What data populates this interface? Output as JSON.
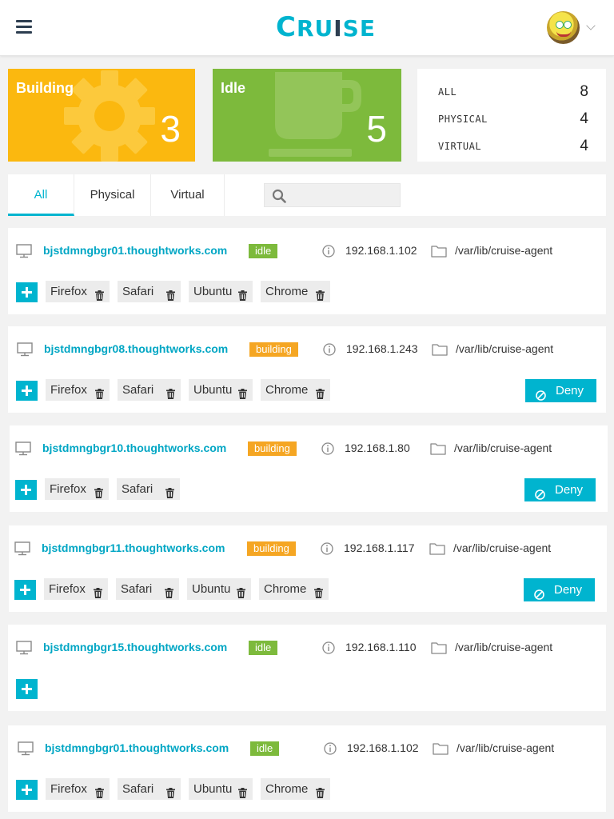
{
  "header": {
    "logo_1": "C",
    "logo_2": "RU",
    "logo_3": "I",
    "logo_4": "SE"
  },
  "summary": {
    "building_label": "Building",
    "building_count": "3",
    "idle_label": "Idle",
    "idle_count": "5",
    "totals": [
      {
        "label": "ALL",
        "value": "8"
      },
      {
        "label": "PHYSICAL",
        "value": "4"
      },
      {
        "label": "VIRTUAL",
        "value": "4"
      }
    ]
  },
  "tabs": [
    "All",
    "Physical",
    "Virtual"
  ],
  "search": {
    "placeholder": ""
  },
  "deny_label": "Deny",
  "agents": [
    {
      "host": "bjstdmngbgr01.thoughtworks.com",
      "status": "idle",
      "ip": "192.168.1.102",
      "path": "/var/lib/cruise-agent",
      "resources": [
        "Firefox",
        "Safari",
        "Ubuntu",
        "Chrome"
      ]
    },
    {
      "host": "bjstdmngbgr08.thoughtworks.com",
      "status": "building",
      "ip": "192.168.1.243",
      "path": "/var/lib/cruise-agent",
      "resources": [
        "Firefox",
        "Safari",
        "Ubuntu",
        "Chrome"
      ]
    },
    {
      "host": "bjstdmngbgr10.thoughtworks.com",
      "status": "building",
      "ip": "192.168.1.80",
      "path": "/var/lib/cruise-agent",
      "resources": [
        "Firefox",
        "Safari"
      ]
    },
    {
      "host": "bjstdmngbgr11.thoughtworks.com",
      "status": "building",
      "ip": "192.168.1.117",
      "path": "/var/lib/cruise-agent",
      "resources": [
        "Firefox",
        "Safari",
        "Ubuntu",
        "Chrome"
      ]
    },
    {
      "host": "bjstdmngbgr15.thoughtworks.com",
      "status": "idle",
      "ip": "192.168.1.110",
      "path": "/var/lib/cruise-agent",
      "resources": []
    },
    {
      "host": "bjstdmngbgr01.thoughtworks.com",
      "status": "idle",
      "ip": "192.168.1.102",
      "path": "/var/lib/cruise-agent",
      "resources": [
        "Firefox",
        "Safari",
        "Ubuntu",
        "Chrome"
      ]
    }
  ],
  "colors": {
    "accent": "#00b4cf",
    "building": "#fbb80f",
    "idle": "#7dba3c",
    "status_building": "#f5a623"
  }
}
